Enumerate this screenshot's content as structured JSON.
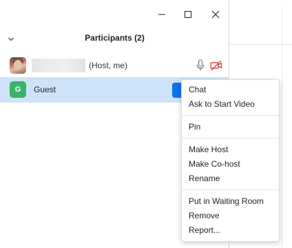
{
  "window_controls": {
    "minimize_icon": "minimize-icon",
    "maximize_icon": "maximize-icon",
    "close_icon": "close-icon"
  },
  "header": {
    "title": "Participants (2)",
    "collapse_icon": "chevron-down-icon"
  },
  "participants": [
    {
      "name": "",
      "role": "(Host, me)",
      "avatar": "photo",
      "mic_icon": "microphone-icon",
      "video_icon": "video-off-icon",
      "video_off_color": "#e02828"
    },
    {
      "name": "Guest",
      "avatar_initial": "G",
      "avatar_color": "#3ab36b",
      "highlight_color": "#cfe3f8",
      "more_button_color": "#0e72ed"
    }
  ],
  "context_menu": {
    "groups": [
      [
        "Chat",
        "Ask to Start Video"
      ],
      [
        "Pin"
      ],
      [
        "Make Host",
        "Make Co-host",
        "Rename"
      ],
      [
        "Put in Waiting Room",
        "Remove",
        "Report..."
      ]
    ]
  }
}
